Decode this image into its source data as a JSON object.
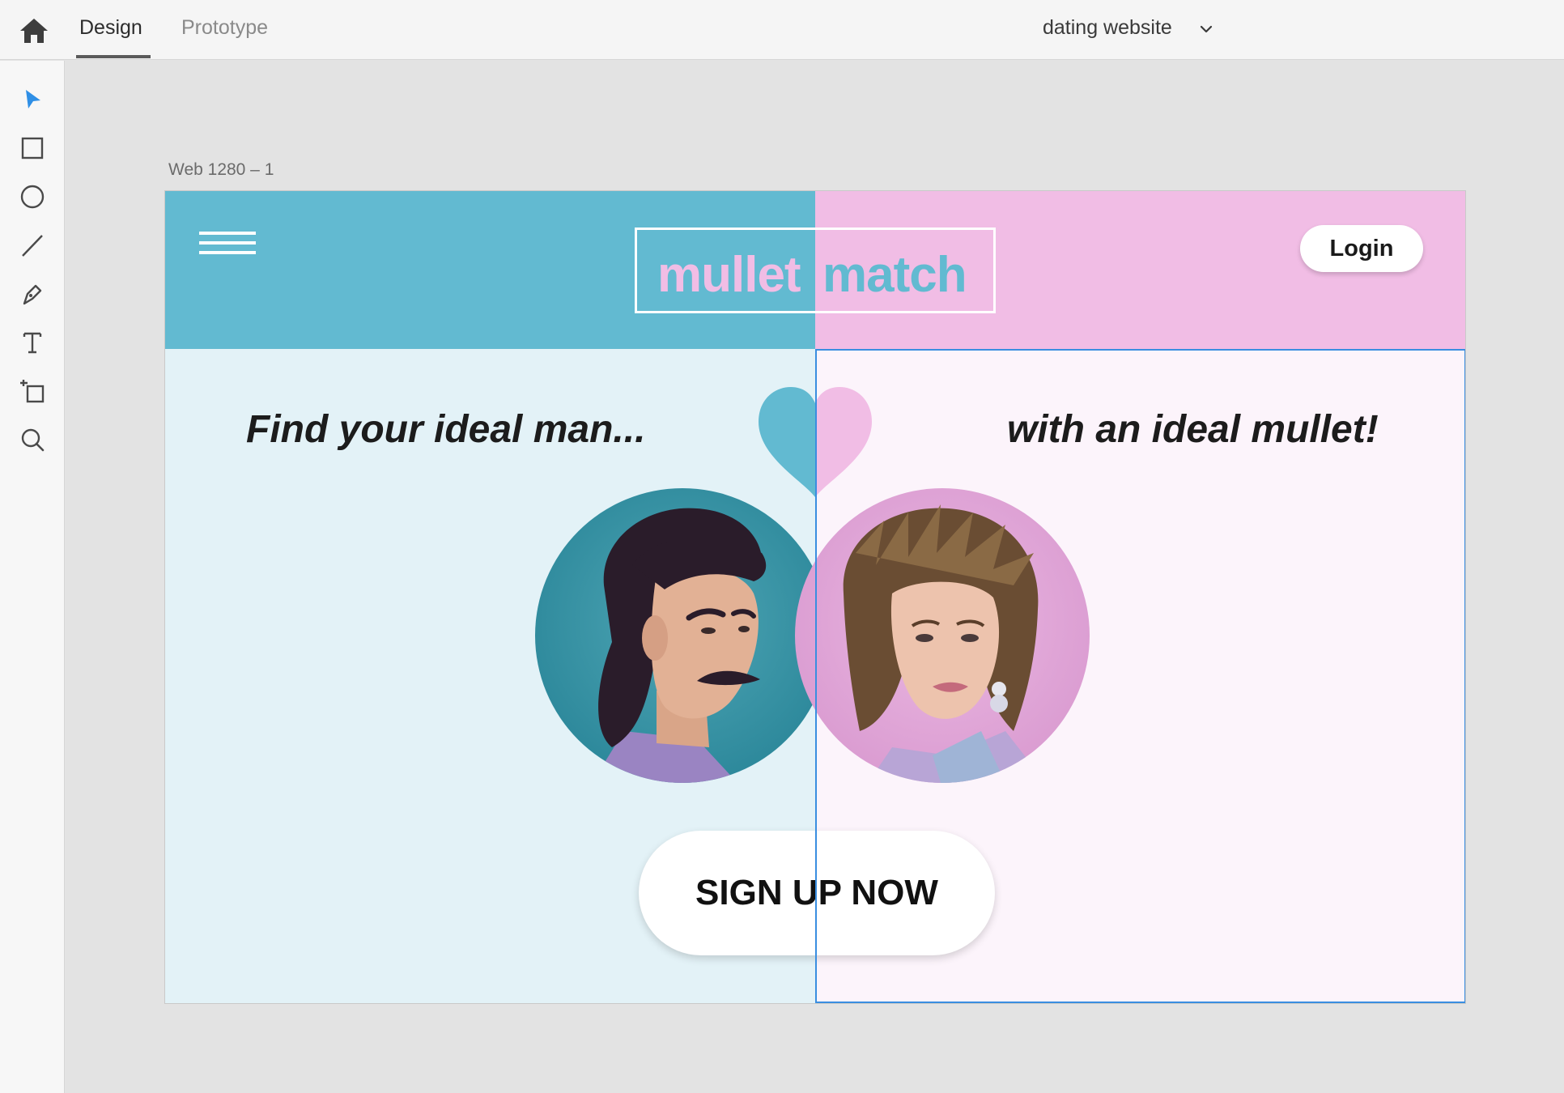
{
  "app": {
    "tabs": [
      {
        "label": "Design",
        "active": true
      },
      {
        "label": "Prototype",
        "active": false
      }
    ],
    "document_title": "dating website"
  },
  "icons": {
    "home": "home-icon",
    "doc_menu": "chevron-down-icon",
    "tools": [
      "select-icon",
      "rectangle-icon",
      "ellipse-icon",
      "line-icon",
      "pen-icon",
      "text-icon",
      "artboard-icon",
      "zoom-icon"
    ]
  },
  "artboard": {
    "label": "Web 1280 – 1"
  },
  "site": {
    "logo_part1": "mullet",
    "logo_part2": "match",
    "login_label": "Login",
    "tagline_left": "Find your ideal man...",
    "tagline_right": "with an ideal mullet!",
    "signup_label": "SIGN UP NOW"
  },
  "colors": {
    "blue": "#62bad1",
    "pink": "#f1bde5",
    "light_blue": "#e3f2f7",
    "light_pink": "#fcf4fb",
    "selection": "#3a8ee0"
  }
}
